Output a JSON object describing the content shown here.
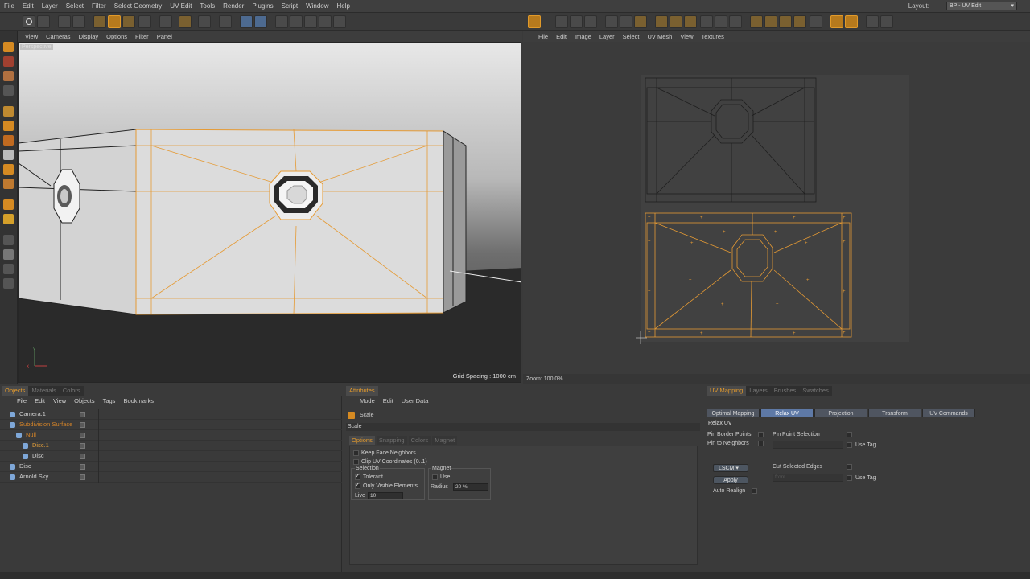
{
  "menu": [
    "File",
    "Edit",
    "Layer",
    "Select",
    "Filter",
    "Select Geometry",
    "UV Edit",
    "Tools",
    "Render",
    "Plugins",
    "Script",
    "Window",
    "Help"
  ],
  "layout": {
    "label": "Layout:",
    "value": "BP - UV Edit"
  },
  "viewport": {
    "menu": [
      "View",
      "Cameras",
      "Display",
      "Options",
      "Filter",
      "Panel"
    ],
    "label": "Perspective",
    "grid_spacing": "Grid Spacing : 1000 cm"
  },
  "uv_view": {
    "menu": [
      "File",
      "Edit",
      "Image",
      "Layer",
      "Select",
      "UV Mesh",
      "View",
      "Textures"
    ],
    "zoom": "Zoom: 100.0%"
  },
  "objects_panel": {
    "tabs": [
      "Objects",
      "Materials",
      "Colors"
    ],
    "menu": [
      "File",
      "Edit",
      "View",
      "Objects",
      "Tags",
      "Bookmarks"
    ],
    "rows": [
      {
        "name": "Camera.1",
        "color": "#d0d0d0",
        "indent": 0
      },
      {
        "name": "Subdivision Surface",
        "color": "#d58428",
        "indent": 0
      },
      {
        "name": "Null",
        "color": "#d58428",
        "indent": 1
      },
      {
        "name": "Disc.1",
        "color": "#e8a23a",
        "indent": 2
      },
      {
        "name": "Disc",
        "color": "#d0d0d0",
        "indent": 2
      },
      {
        "name": "Disc",
        "color": "#d0d0d0",
        "indent": 0
      },
      {
        "name": "Arnold Sky",
        "color": "#d0d0d0",
        "indent": 0
      }
    ]
  },
  "attributes_panel": {
    "tab": "Attributes",
    "menu": [
      "Mode",
      "Edit",
      "User Data"
    ],
    "tool_name": "Scale",
    "section_bar": "Scale",
    "subtabs": [
      "Options",
      "Snapping",
      "Colors",
      "Magnet"
    ],
    "keep_face_neighbors": "Keep Face Neighbors",
    "clip_uv": "Clip UV Coordinates (0..1)",
    "selection_title": "Selection",
    "tolerant": "Tolerant",
    "only_visible": "Only Visible Elements",
    "live_label": "Live",
    "live_value": "10",
    "magnet_title": "Magnet",
    "use": "Use",
    "radius_label": "Radius",
    "radius_value": "20 %"
  },
  "uv_panel": {
    "tabs": [
      "UV Mapping",
      "Layers",
      "Brushes",
      "Swatches"
    ],
    "commands": [
      "Optimal Mapping",
      "Relax UV",
      "Projection",
      "Transform",
      "UV Commands"
    ],
    "active_command": "Relax UV",
    "section": "Relax UV",
    "pin_border": "Pin Border Points",
    "pin_neighbors": "Pin to Neighbors",
    "pin_point_sel": "Pin Point Selection",
    "use_tag": "Use Tag",
    "cut_selected": "Cut Selected Edges",
    "front": "front",
    "use_tag2": "Use Tag",
    "method": "LSCM",
    "apply": "Apply",
    "auto_realign": "Auto Realign"
  }
}
